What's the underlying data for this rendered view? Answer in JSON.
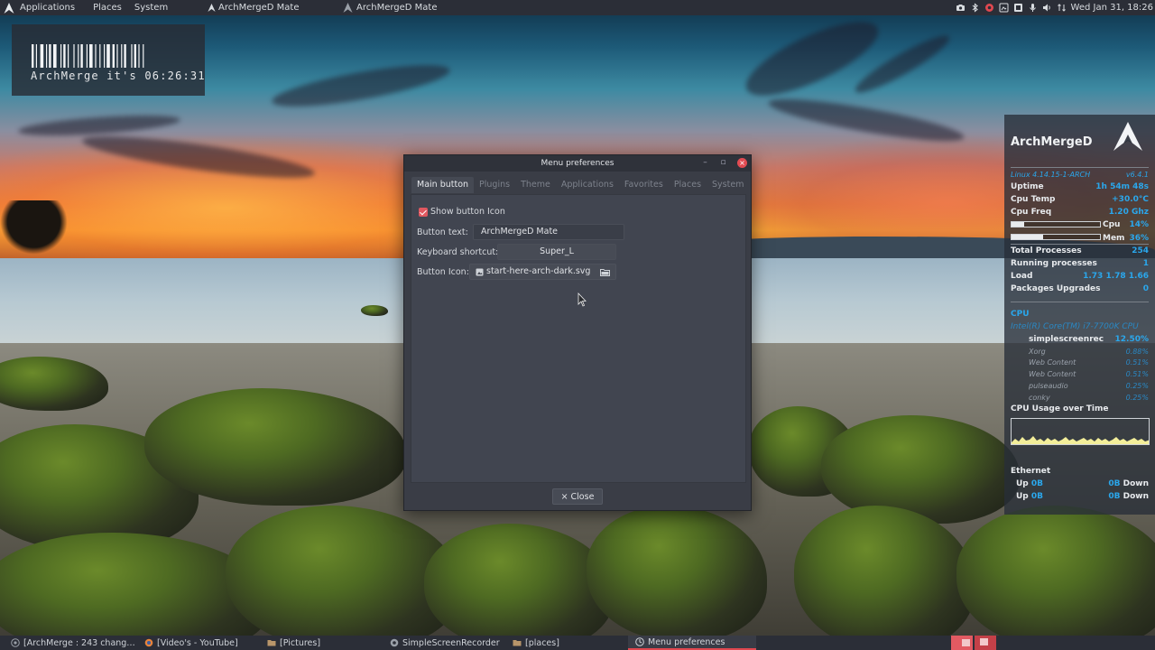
{
  "top_panel": {
    "menus": [
      "Applications",
      "Places",
      "System"
    ],
    "window_buttons": [
      "ArchMergeD Mate",
      "ArchMergeD Mate"
    ],
    "clock": "Wed Jan 31, 18:26"
  },
  "clock_widget": {
    "text": "ArchMerge it's 06:26:31"
  },
  "conky": {
    "title": "ArchMergeD",
    "kernel": "Linux 4.14.15-1-ARCH",
    "version": "v6.4.1",
    "uptime_label": "Uptime",
    "uptime_value": "1h 54m 48s",
    "cputemp_label": "Cpu Temp",
    "cputemp_value": "+30.0°C",
    "cpufreq_label": "Cpu Freq",
    "cpufreq_value": "1.20 Ghz",
    "cpu_bar_label": "Cpu",
    "cpu_bar_value": "14%",
    "cpu_bar_fraction": 0.14,
    "mem_bar_label": "Mem",
    "mem_bar_value": "36%",
    "mem_bar_fraction": 0.36,
    "total_proc_label": "Total Processes",
    "total_proc_value": "254",
    "running_proc_label": "Running processes",
    "running_proc_value": "1",
    "load_label": "Load",
    "load_value": "1.73 1.78 1.66",
    "pkg_label": "Packages Upgrades",
    "pkg_value": "0",
    "cpu_section": "CPU",
    "cpu_model": "Intel(R) Core(TM) i7-7700K CPU",
    "processes": [
      {
        "name": "simplescreenrec",
        "value": "12.50%"
      },
      {
        "name": "Xorg",
        "value": "0.88%"
      },
      {
        "name": "Web Content",
        "value": "0.51%"
      },
      {
        "name": "Web Content",
        "value": "0.51%"
      },
      {
        "name": "pulseaudio",
        "value": "0.25%"
      },
      {
        "name": "conky",
        "value": "0.25%"
      }
    ],
    "graph_title": "CPU Usage over Time",
    "ethernet_label": "Ethernet",
    "net": [
      {
        "up_label": "Up",
        "up_value": "0B",
        "down_value": "0B",
        "down_label": "Down"
      },
      {
        "up_label": "Up",
        "up_value": "0B",
        "down_value": "0B",
        "down_label": "Down"
      }
    ]
  },
  "dialog": {
    "title": "Menu preferences",
    "tabs": [
      "Main button",
      "Plugins",
      "Theme",
      "Applications",
      "Favorites",
      "Places",
      "System"
    ],
    "active_tab": 0,
    "show_button_icon_label": "Show button Icon",
    "show_button_icon_checked": true,
    "button_text_label": "Button text:",
    "button_text_value": "ArchMergeD Mate",
    "keyboard_shortcut_label": "Keyboard shortcut:",
    "keyboard_shortcut_value": "Super_L",
    "button_icon_label": "Button Icon:",
    "button_icon_value": "start-here-arch-dark.svg",
    "close_label": "Close"
  },
  "taskbar": {
    "tasks": [
      {
        "label": "[ArchMerge : 243 chang…",
        "active": false
      },
      {
        "label": "[Video's - YouTube]",
        "active": false
      },
      {
        "label": "[Pictures]",
        "active": false
      },
      {
        "label": "SimpleScreenRecorder",
        "active": false
      },
      {
        "label": "[places]",
        "active": false
      },
      {
        "label": "Menu preferences",
        "active": true
      }
    ]
  },
  "colors": {
    "accent": "#e04850",
    "conky_value": "#2aa7ec",
    "panel_bg": "#2b2e37",
    "dialog_bg": "#3a3d46"
  }
}
